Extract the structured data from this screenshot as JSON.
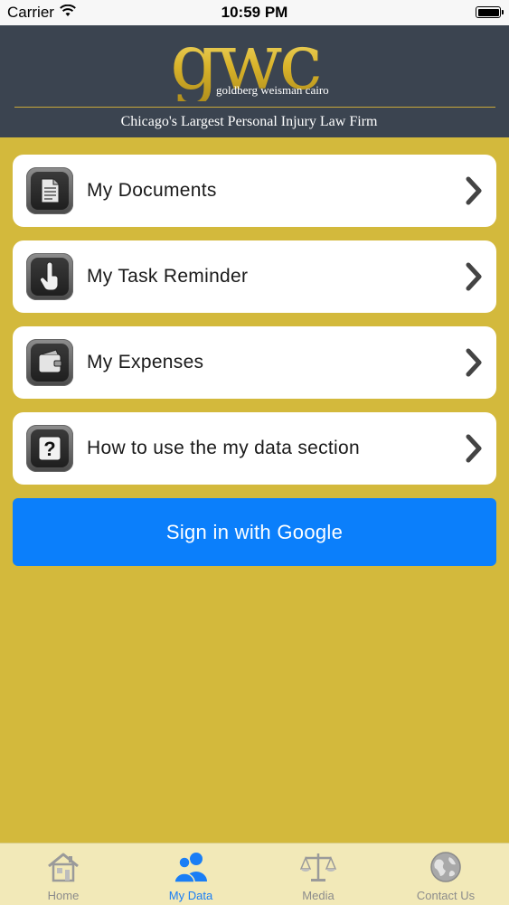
{
  "status_bar": {
    "carrier": "Carrier",
    "time": "10:59 PM"
  },
  "header": {
    "logo": "gwc",
    "logo_subtitle": "goldberg weisman cairo",
    "tagline": "Chicago's Largest Personal Injury Law Firm"
  },
  "menu": [
    {
      "label": "My Documents",
      "icon": "document-icon"
    },
    {
      "label": "My Task Reminder",
      "icon": "touch-hand-icon"
    },
    {
      "label": "My Expenses",
      "icon": "wallet-icon"
    },
    {
      "label": "How to use the my data section",
      "icon": "help-icon"
    }
  ],
  "google_button": {
    "label": "Sign in with Google"
  },
  "tabs": [
    {
      "label": "Home",
      "icon": "home-icon",
      "active": false
    },
    {
      "label": "My Data",
      "icon": "users-icon",
      "active": true
    },
    {
      "label": "Media",
      "icon": "scales-icon",
      "active": false
    },
    {
      "label": "Contact Us",
      "icon": "globe-icon",
      "active": false
    }
  ],
  "colors": {
    "background": "#d3b93c",
    "header": "#3b4450",
    "logo_gold": "#e9c832",
    "button_blue": "#0b7ffb",
    "tab_active": "#1a7ef5",
    "tab_bar": "#f2e9b8"
  }
}
